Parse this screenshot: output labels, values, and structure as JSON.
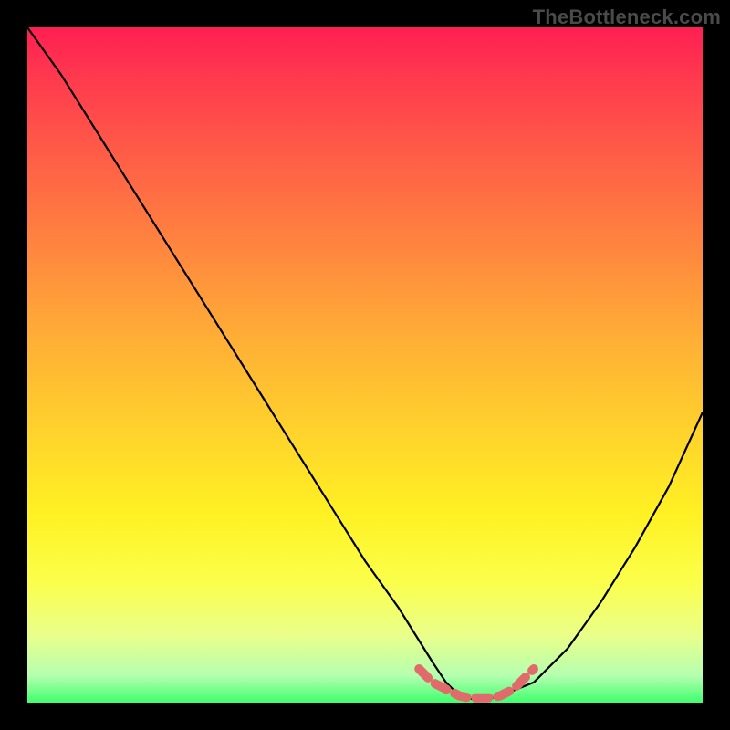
{
  "watermark": "TheBottleneck.com",
  "chart_data": {
    "type": "line",
    "title": "",
    "xlabel": "",
    "ylabel": "",
    "xlim": [
      0,
      100
    ],
    "ylim": [
      0,
      100
    ],
    "gradient_meaning": "top (red) = high bottleneck, bottom (green) = low bottleneck",
    "series": [
      {
        "name": "bottleneck-curve",
        "color": "#000000",
        "x": [
          0,
          5,
          10,
          15,
          20,
          25,
          30,
          35,
          40,
          45,
          50,
          55,
          60,
          62,
          64,
          66,
          68,
          70,
          75,
          80,
          85,
          90,
          95,
          100
        ],
        "y": [
          100,
          93,
          85,
          77,
          69,
          61,
          53,
          45,
          37,
          29,
          21,
          14,
          6,
          3,
          1,
          0.5,
          0.5,
          1,
          3,
          8,
          15,
          23,
          32,
          43
        ]
      },
      {
        "name": "optimal-zone-marker",
        "color": "#e16a6a",
        "stroke_width": 10,
        "x": [
          58,
          60,
          62,
          63,
          64,
          65,
          66,
          67,
          68,
          69,
          70,
          71,
          72,
          73,
          74,
          75
        ],
        "y": [
          5,
          3,
          2,
          1.5,
          1,
          0.8,
          0.7,
          0.7,
          0.7,
          0.8,
          1,
          1.5,
          2,
          3,
          4,
          5
        ]
      }
    ]
  }
}
